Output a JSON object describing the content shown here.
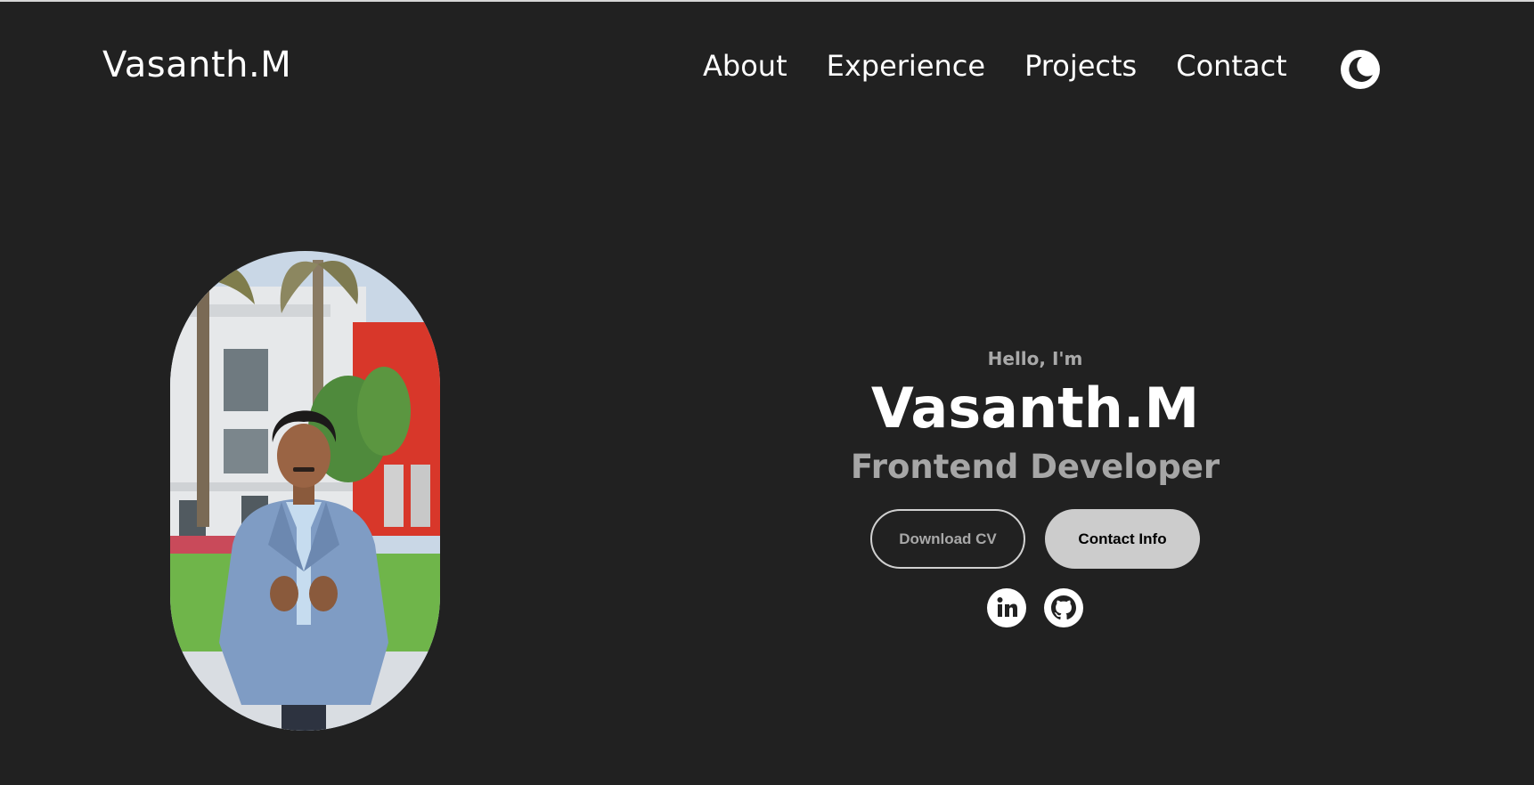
{
  "header": {
    "logo": "Vasanth.M",
    "nav": [
      {
        "label": "About"
      },
      {
        "label": "Experience"
      },
      {
        "label": "Projects"
      },
      {
        "label": "Contact"
      }
    ],
    "theme_toggle_icon": "moon-icon"
  },
  "hero": {
    "greeting": "Hello, I'm",
    "name": "Vasanth.M",
    "role": "Frontend Developer",
    "download_cv_label": "Download CV",
    "contact_info_label": "Contact Info",
    "socials": [
      {
        "icon": "linkedin-icon"
      },
      {
        "icon": "github-icon"
      }
    ]
  },
  "colors": {
    "background": "#212121",
    "text": "#ffffff",
    "muted_text": "#a6a6a6",
    "button_fill": "#cccccc"
  }
}
